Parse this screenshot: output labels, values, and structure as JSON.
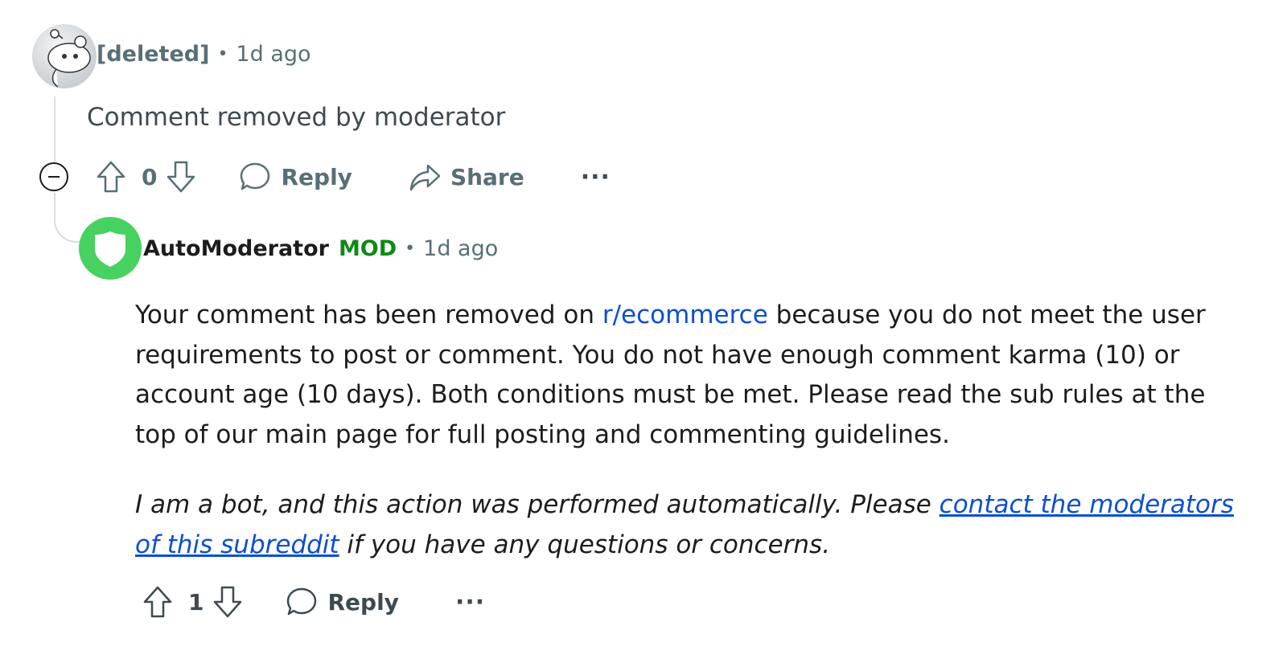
{
  "comment_deleted": {
    "username": "[deleted]",
    "separator": "•",
    "time": "1d ago",
    "body": "Comment removed by moderator",
    "score": "0",
    "reply_label": "Reply",
    "share_label": "Share",
    "more_label": "···"
  },
  "comment_automod": {
    "username": "AutoModerator",
    "badge": "MOD",
    "separator": "•",
    "time": "1d ago",
    "body_part1": "Your comment has been removed on ",
    "subreddit_link": "r/ecommerce",
    "body_part2": " because you do not meet the user requirements to post or comment. You do not have enough comment karma (10) or account age (10 days). Both conditions must be met. Please read the sub rules at the top of our main page for full posting and commenting guidelines.",
    "bot_part1": "I am a bot, and this action was performed automatically. Please ",
    "bot_link": "contact the moderators of this subreddit",
    "bot_part2": " if you have any questions or concerns.",
    "score": "1",
    "reply_label": "Reply",
    "more_label": "···"
  },
  "colors": {
    "mod_green": "#46d160",
    "mod_badge": "#0e8a16",
    "link": "#0b4fd1",
    "meta_gray": "#576f76"
  },
  "icons": [
    "snoo-avatar-icon",
    "shield-icon",
    "upvote-icon",
    "downvote-icon",
    "comment-icon",
    "share-icon",
    "collapse-icon",
    "more-icon"
  ]
}
